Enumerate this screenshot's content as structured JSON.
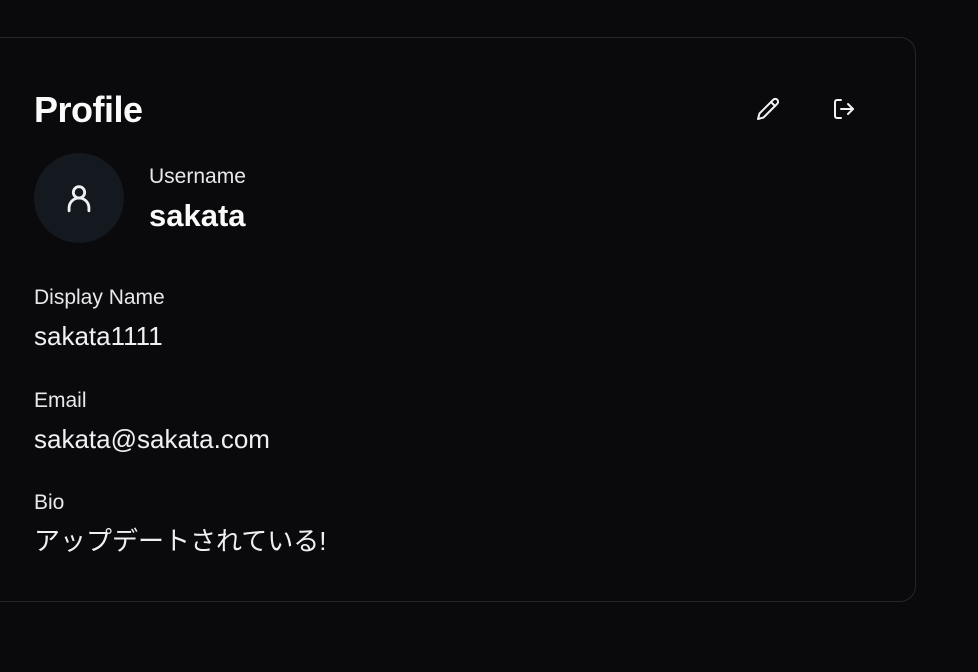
{
  "profile": {
    "title": "Profile",
    "actions": {
      "edit_icon": "pencil-icon",
      "logout_icon": "logout-icon"
    },
    "avatar_icon": "user-icon",
    "username_label": "Username",
    "username": "sakata",
    "display_name_label": "Display Name",
    "display_name": "sakata1111",
    "email_label": "Email",
    "email": "sakata@sakata.com",
    "bio_label": "Bio",
    "bio": "アップデートされている!"
  },
  "colors": {
    "background": "#0a0a0c",
    "card_border": "#24262b",
    "avatar_bg": "#14181f",
    "text": "#f5f5f6"
  }
}
